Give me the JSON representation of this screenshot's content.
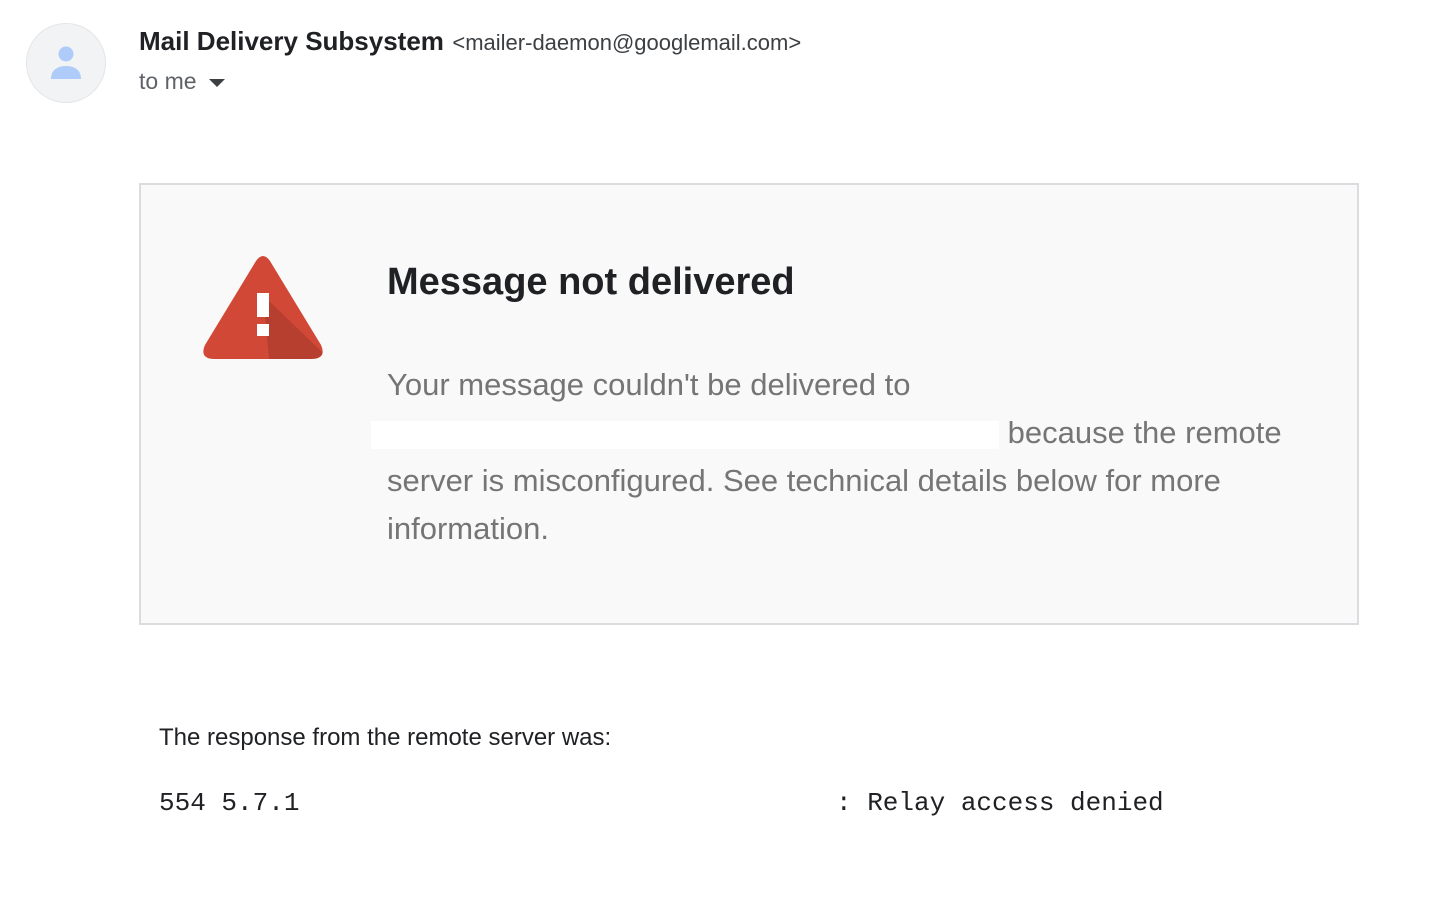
{
  "header": {
    "sender_name": "Mail Delivery Subsystem",
    "sender_email": "<mailer-daemon@googlemail.com>",
    "recipient_label": "to me",
    "avatar_icon": "person-icon",
    "dropdown_icon": "chevron-down-icon"
  },
  "notice": {
    "icon": "warning-icon",
    "icon_color": "#d14836",
    "title": "Message not delivered",
    "body_part1": "Your message couldn't be delivered to",
    "body_part2": "because the remote server is misconfigured. See technical details below for more information."
  },
  "response": {
    "label": "The response from the remote server was:",
    "code": "554 5.7.1",
    "detail": ": Relay access denied"
  }
}
